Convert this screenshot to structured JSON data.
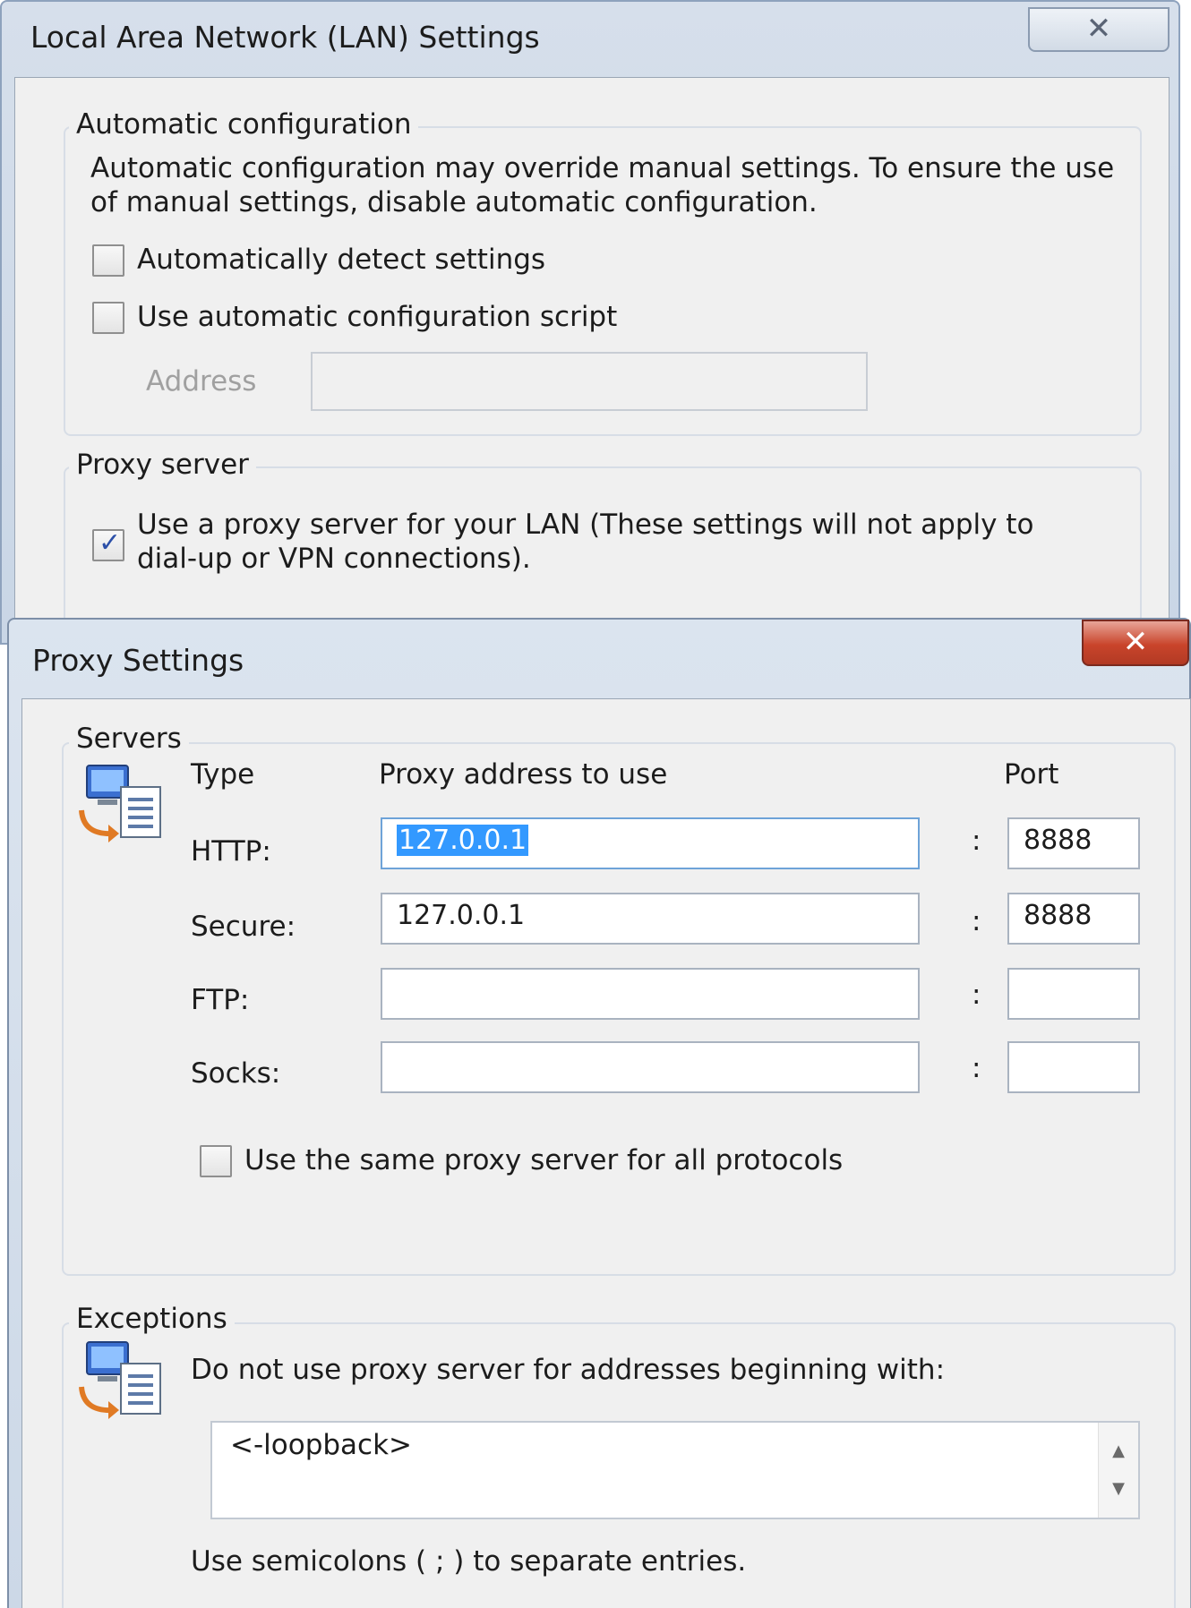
{
  "lan_dialog": {
    "title": "Local Area Network (LAN) Settings",
    "close_glyph": "✕",
    "auto_config": {
      "group_label": "Automatic configuration",
      "description": "Automatic configuration may override manual settings.  To ensure the use of manual settings, disable automatic configuration.",
      "auto_detect_label": "Automatically detect settings",
      "auto_detect_checked": false,
      "use_script_label": "Use automatic configuration script",
      "use_script_checked": false,
      "address_label": "Address",
      "address_value": ""
    },
    "proxy_server": {
      "group_label": "Proxy server",
      "use_proxy_label_line1": "Use a proxy server for your LAN (These settings will not apply to",
      "use_proxy_label_line2": "dial-up or VPN connections).",
      "use_proxy_checked": true
    }
  },
  "proxy_dialog": {
    "title": "Proxy Settings",
    "close_glyph": "✕",
    "servers": {
      "group_label": "Servers",
      "col_type": "Type",
      "col_address": "Proxy address to use",
      "col_port": "Port",
      "separator": ":",
      "rows": [
        {
          "label": "HTTP:",
          "address": "127.0.0.1",
          "port": "8888"
        },
        {
          "label": "Secure:",
          "address": "127.0.0.1",
          "port": "8888"
        },
        {
          "label": "FTP:",
          "address": "",
          "port": ""
        },
        {
          "label": "Socks:",
          "address": "",
          "port": ""
        }
      ],
      "same_proxy_label": "Use the same proxy server for all protocols",
      "same_proxy_checked": false
    },
    "exceptions": {
      "group_label": "Exceptions",
      "description": "Do not use proxy server for addresses beginning with:",
      "value": "<-loopback>",
      "hint": "Use semicolons ( ; ) to separate entries."
    }
  },
  "icons": {
    "network": "network-settings-icon",
    "scroll_up": "▲",
    "scroll_down": "▼"
  }
}
